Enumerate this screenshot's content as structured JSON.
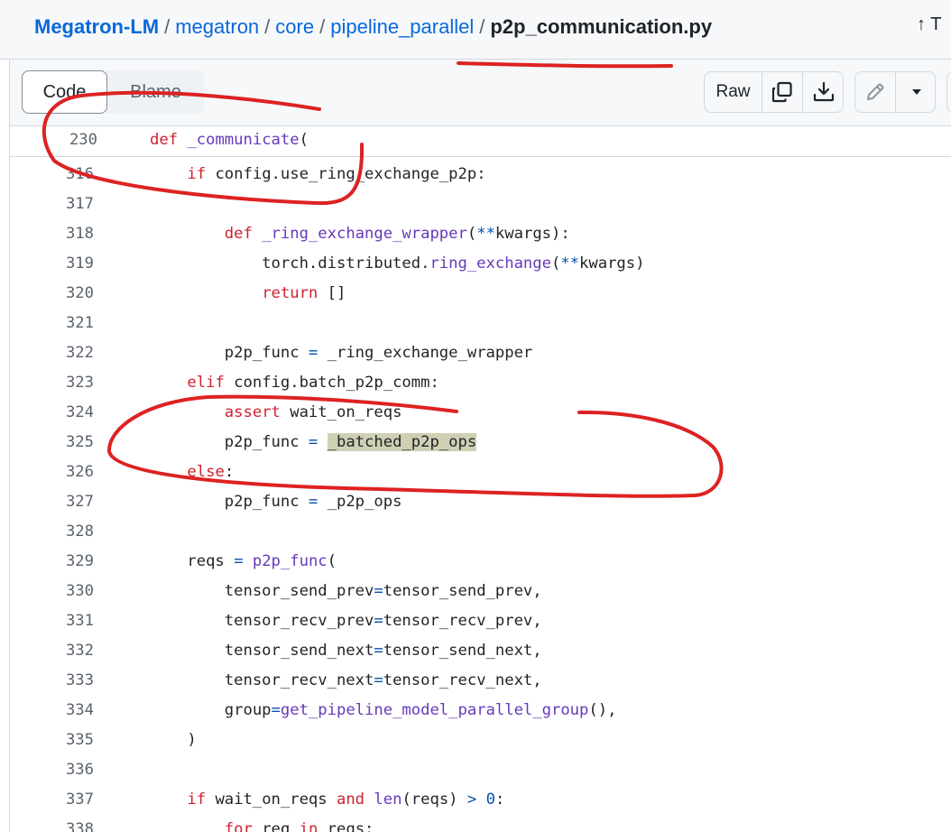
{
  "breadcrumb": {
    "repo": "Megatron-LM",
    "sep": "/",
    "path": [
      "megatron",
      "core",
      "pipeline_parallel"
    ],
    "file": "p2p_communication.py",
    "top_label": "↑ T"
  },
  "toolbar": {
    "code_tab": "Code",
    "blame_tab": "Blame",
    "raw_label": "Raw",
    "icons": [
      "copy-icon",
      "download-icon",
      "pencil-icon",
      "triangle-down-icon"
    ]
  },
  "colors": {
    "annotation": "#dd2222",
    "keyword": "#cf222e",
    "function": "#6639ba",
    "operator": "#0550ae",
    "highlight": "#cfcfb3"
  },
  "sticky_line": {
    "num": "230",
    "tokens": [
      [
        "kw",
        "def"
      ],
      [
        "",
        "",
        " "
      ],
      [
        "fn",
        "_communicate"
      ],
      [
        "",
        "("
      ]
    ]
  },
  "lines": [
    {
      "num": "316",
      "tokens": [
        [
          "",
          "    "
        ],
        [
          "kw",
          "if"
        ],
        [
          "",
          " config.use_ring_exchange_p2p:"
        ]
      ]
    },
    {
      "num": "317",
      "tokens": []
    },
    {
      "num": "318",
      "tokens": [
        [
          "",
          "        "
        ],
        [
          "kw",
          "def"
        ],
        [
          "",
          " "
        ],
        [
          "fn",
          "_ring_exchange_wrapper"
        ],
        [
          "",
          "("
        ],
        [
          "op",
          "**"
        ],
        [
          "",
          "kwargs):"
        ]
      ]
    },
    {
      "num": "319",
      "tokens": [
        [
          "",
          "            torch.distributed."
        ],
        [
          "fn",
          "ring_exchange"
        ],
        [
          "",
          "("
        ],
        [
          "op",
          "**"
        ],
        [
          "",
          "kwargs)"
        ]
      ]
    },
    {
      "num": "320",
      "tokens": [
        [
          "",
          "            "
        ],
        [
          "kw",
          "return"
        ],
        [
          "",
          " []"
        ]
      ]
    },
    {
      "num": "321",
      "tokens": []
    },
    {
      "num": "322",
      "tokens": [
        [
          "",
          "        p2p_func "
        ],
        [
          "op",
          "="
        ],
        [
          "",
          " _ring_exchange_wrapper"
        ]
      ]
    },
    {
      "num": "323",
      "tokens": [
        [
          "",
          "    "
        ],
        [
          "kw",
          "elif"
        ],
        [
          "",
          " config.batch_p2p_comm:"
        ]
      ]
    },
    {
      "num": "324",
      "tokens": [
        [
          "",
          "        "
        ],
        [
          "kw",
          "assert"
        ],
        [
          "",
          " wait_on_reqs"
        ]
      ]
    },
    {
      "num": "325",
      "tokens": [
        [
          "",
          "        p2p_func "
        ],
        [
          "op",
          "="
        ],
        [
          "",
          " "
        ],
        [
          "hl",
          "_batched_p2p_ops"
        ]
      ]
    },
    {
      "num": "326",
      "tokens": [
        [
          "",
          "    "
        ],
        [
          "kw",
          "else"
        ],
        [
          "",
          ":"
        ]
      ]
    },
    {
      "num": "327",
      "tokens": [
        [
          "",
          "        p2p_func "
        ],
        [
          "op",
          "="
        ],
        [
          "",
          " _p2p_ops"
        ]
      ]
    },
    {
      "num": "328",
      "tokens": []
    },
    {
      "num": "329",
      "tokens": [
        [
          "",
          "    reqs "
        ],
        [
          "op",
          "="
        ],
        [
          "",
          " "
        ],
        [
          "fn",
          "p2p_func"
        ],
        [
          "",
          "("
        ]
      ]
    },
    {
      "num": "330",
      "tokens": [
        [
          "",
          "        tensor_send_prev"
        ],
        [
          "op",
          "="
        ],
        [
          "",
          "tensor_send_prev,"
        ]
      ]
    },
    {
      "num": "331",
      "tokens": [
        [
          "",
          "        tensor_recv_prev"
        ],
        [
          "op",
          "="
        ],
        [
          "",
          "tensor_recv_prev,"
        ]
      ]
    },
    {
      "num": "332",
      "tokens": [
        [
          "",
          "        tensor_send_next"
        ],
        [
          "op",
          "="
        ],
        [
          "",
          "tensor_send_next,"
        ]
      ]
    },
    {
      "num": "333",
      "tokens": [
        [
          "",
          "        tensor_recv_next"
        ],
        [
          "op",
          "="
        ],
        [
          "",
          "tensor_recv_next,"
        ]
      ]
    },
    {
      "num": "334",
      "tokens": [
        [
          "",
          "        group"
        ],
        [
          "op",
          "="
        ],
        [
          "fn",
          "get_pipeline_model_parallel_group"
        ],
        [
          "",
          "(),"
        ]
      ]
    },
    {
      "num": "335",
      "tokens": [
        [
          "",
          "    )"
        ]
      ]
    },
    {
      "num": "336",
      "tokens": []
    },
    {
      "num": "337",
      "tokens": [
        [
          "",
          "    "
        ],
        [
          "kw",
          "if"
        ],
        [
          "",
          " wait_on_reqs "
        ],
        [
          "kw",
          "and"
        ],
        [
          "",
          " "
        ],
        [
          "fn",
          "len"
        ],
        [
          "",
          "(reqs) "
        ],
        [
          "op",
          ">"
        ],
        [
          "",
          " "
        ],
        [
          "op",
          "0"
        ],
        [
          "",
          ":"
        ]
      ]
    },
    {
      "num": "338",
      "tokens": [
        [
          "",
          "        "
        ],
        [
          "kw",
          "for"
        ],
        [
          "",
          " req "
        ],
        [
          "kw",
          "in"
        ],
        [
          "",
          " reqs:"
        ]
      ]
    }
  ]
}
